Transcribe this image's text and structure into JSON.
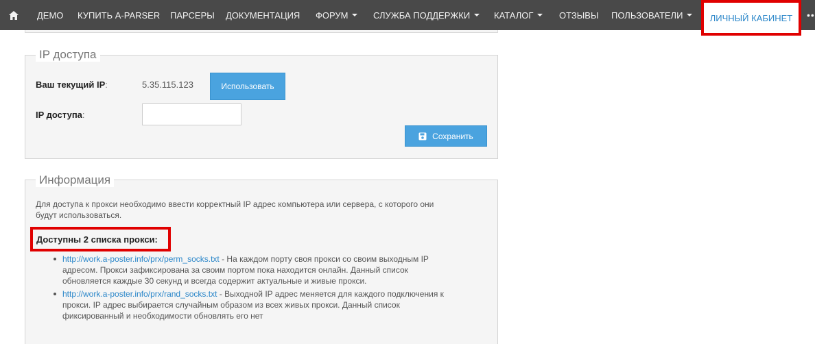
{
  "nav": {
    "home_icon": "home-icon",
    "items": [
      {
        "label": "ДЕМО",
        "dropdown": false
      },
      {
        "label": "КУПИТЬ A-PARSER",
        "dropdown": false
      },
      {
        "label": "ПАРСЕРЫ",
        "dropdown": false
      },
      {
        "label": "ДОКУМЕНТАЦИЯ",
        "dropdown": false
      },
      {
        "label": "ФОРУМ",
        "dropdown": true
      },
      {
        "label": "СЛУЖБА ПОДДЕРЖКИ",
        "dropdown": true
      },
      {
        "label": "КАТАЛОГ",
        "dropdown": true
      },
      {
        "label": "ОТЗЫВЫ",
        "dropdown": false
      },
      {
        "label": "ПОЛЬЗОВАТЕЛИ",
        "dropdown": true
      }
    ],
    "active": "ЛИЧНЫЙ КАБИНЕТ",
    "more": "•••"
  },
  "ip_panel": {
    "legend": "IP доступа",
    "current_ip_label": "Ваш текущий IP",
    "current_ip_value": "5.35.115.123",
    "use_button": "Использовать",
    "access_ip_label": "IP доступа",
    "access_ip_value": "",
    "save_button": "Сохранить"
  },
  "info_panel": {
    "legend": "Информация",
    "intro_line1": "Для доступа к прокси необходимо ввести корректный IP адрес компьютера или сервера, с которого они",
    "intro_line2": "будут использоваться.",
    "heading": "Доступны 2 списка прокси:",
    "items": [
      {
        "link": "http://work.a-poster.info/prx/perm_socks.txt",
        "line1": " - На каждом порту своя прокси со своим выходным IP",
        "line2": "адресом. Прокси зафиксирована за своим портом пока находится онлайн. Данный список",
        "line3": "обновляется каждые 30 секунд и всегда содержит актуальные и живые прокси."
      },
      {
        "link": "http://work.a-poster.info/prx/rand_socks.txt",
        "line1": " - Выходной IP адрес меняется для каждого подключения к",
        "line2": "прокси. IP адрес выбирается случайным образом из всех живых прокси. Данный список",
        "line3": "фиксированный и необходимости обновлять его нет"
      }
    ]
  },
  "colors": {
    "navbar": "#494949",
    "accent": "#2a86c9",
    "button": "#4aa3df",
    "highlight": "#e00000"
  }
}
